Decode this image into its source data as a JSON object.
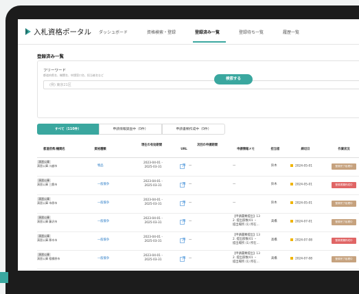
{
  "header": {
    "app_title": "入札資格ポータル",
    "nav": [
      {
        "label": "ダッシュボード"
      },
      {
        "label": "資格検索・登録"
      },
      {
        "label": "登録済み一覧"
      },
      {
        "label": "登録待ち一覧"
      },
      {
        "label": "履歴一覧"
      }
    ]
  },
  "page": {
    "title": "登録済み一覧"
  },
  "search": {
    "keyword_label": "フリーワード",
    "keyword_hint": "都道府県名、機関名、申請窓口名、担当者名など",
    "placeholder": "(例) 東京21区",
    "button_label": "検索する"
  },
  "tabs": [
    {
      "label": "すべて（110件）"
    },
    {
      "label": "申請情報調査中（0件）"
    },
    {
      "label": "申請書類作成中（0件）"
    }
  ],
  "table": {
    "headers": [
      "都道府県/機関名",
      "資格種類",
      "現在の有効期間",
      "URL",
      "次回の申請期間",
      "申請情報メモ",
      "担当者",
      "締切日",
      "作業状況"
    ],
    "rows": [
      {
        "org": [
          "演習公庫",
          "演習公庫 川越市"
        ],
        "qual": "物品",
        "valid": [
          "2023-04-01 -",
          "2025-03-31"
        ],
        "next": "—",
        "memo": [
          "—"
        ],
        "person": "鈴木",
        "deadline": "2024-05-01",
        "status": "登録完了処理中",
        "status_color": "#c6a27e"
      },
      {
        "org": [
          "演習公庫",
          "演習公庫 三鷹市"
        ],
        "qual": "一般競争",
        "valid": [
          "2023-04-01 -",
          "2025-03-31"
        ],
        "next": "—",
        "memo": [
          "—"
        ],
        "person": "鈴木",
        "deadline": "2024-05-01",
        "status": "登録書類作成中",
        "status_color": "#e06565"
      },
      {
        "org": [
          "演習公庫",
          "演習公庫 市原市"
        ],
        "qual": "一般競争",
        "valid": [
          "2023-04-01 -",
          "2025-03-31"
        ],
        "next": "—",
        "memo": [
          "—"
        ],
        "person": "鈴木",
        "deadline": "2024-05-01",
        "status": "登録完了処理中",
        "status_color": "#c6a27e"
      },
      {
        "org": [
          "演習公庫",
          "演習公庫 藤沢市"
        ],
        "qual": "一般競争",
        "valid": [
          "2023-04-01 -",
          "2025-03-31"
        ],
        "next": "—",
        "memo": [
          "【申請書類提出】13",
          "2. 提出部数/01 ・",
          "提出場所 (1) 所在..."
        ],
        "person": "高橋",
        "deadline": "2024-07-01",
        "status": "登録完了処理中",
        "status_color": "#c6a27e"
      },
      {
        "org": [
          "演習公庫",
          "演習公庫 厚木市"
        ],
        "qual": "一般競争",
        "valid": [
          "2023-04-01 -",
          "2025-03-31"
        ],
        "next": "—",
        "memo": [
          "【申請書類提出】13",
          "2. 提出部数/01 ・",
          "提出場所 (1) 所在..."
        ],
        "person": "高橋",
        "deadline": "2024-07-08",
        "status": "登録書類作成中",
        "status_color": "#e06565"
      },
      {
        "org": [
          "演習公庫",
          "演習公庫 相模原市"
        ],
        "qual": "一般競争",
        "valid": [
          "2023-04-01 -",
          "2025-03-31"
        ],
        "next": "—",
        "memo": [
          "【申請書類提出】13",
          "2. 提出部数/01 ・",
          "提出場所 (1) 所在..."
        ],
        "person": "高橋",
        "deadline": "2024-07-08",
        "status": "登録完了処理中",
        "status_color": "#c6a27e"
      }
    ]
  },
  "colors": {
    "accent": "#3aa79f",
    "status_tan": "#c6a27e",
    "status_red": "#e06565",
    "deadline_dot": "#f0b400",
    "link": "#2f7fc8"
  }
}
